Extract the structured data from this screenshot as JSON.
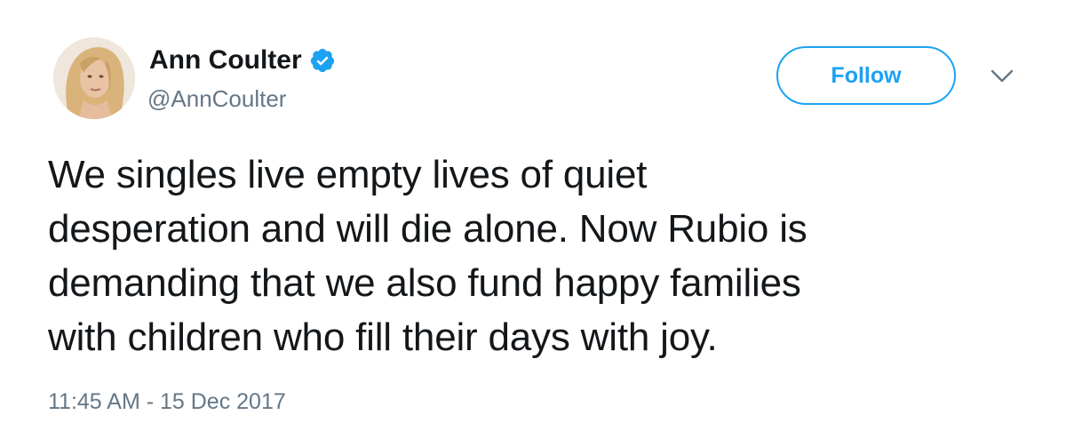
{
  "tweet": {
    "author": {
      "display_name": "Ann Coulter",
      "handle": "@AnnCoulter",
      "verified": true
    },
    "follow_label": "Follow",
    "text_lines": [
      "We singles live empty lives of quiet",
      "desperation and will die alone. Now Rubio is",
      "demanding that we also fund happy families",
      "with children who fill their days with joy."
    ],
    "timestamp": "11:45 AM - 15 Dec 2017"
  },
  "colors": {
    "accent": "#1da1f2",
    "text": "#14171a",
    "secondary_text": "#657786"
  },
  "icons": {
    "verified": "verified-badge-icon",
    "caret": "chevron-down-icon"
  }
}
